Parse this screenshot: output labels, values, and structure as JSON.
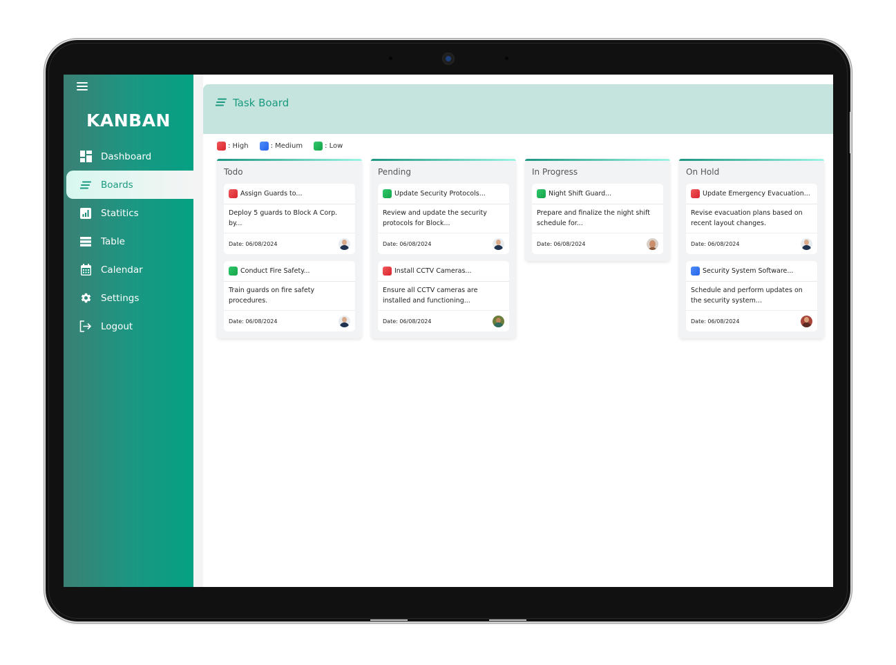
{
  "app": {
    "brand": "KANBAN",
    "menu_icon": "hamburger-icon"
  },
  "sidebar": {
    "items": [
      {
        "label": "Dashboard",
        "icon": "dashboard-icon",
        "active": false
      },
      {
        "label": "Boards",
        "icon": "boards-icon",
        "active": true
      },
      {
        "label": "Statitics",
        "icon": "statistics-icon",
        "active": false
      },
      {
        "label": "Table",
        "icon": "table-icon",
        "active": false
      },
      {
        "label": "Calendar",
        "icon": "calendar-icon",
        "active": false
      },
      {
        "label": "Settings",
        "icon": "gear-icon",
        "active": false
      },
      {
        "label": "Logout",
        "icon": "logout-icon",
        "active": false
      }
    ]
  },
  "header": {
    "title": "Task Board",
    "icon": "boards-icon"
  },
  "legend": [
    {
      "label": ": High",
      "priority": "high",
      "color": "#e53e3e"
    },
    {
      "label": ": Medium",
      "priority": "medium",
      "color": "#3b82f6"
    },
    {
      "label": ": Low",
      "priority": "low",
      "color": "#22c55e"
    }
  ],
  "colors": {
    "accent": "#1a9a80",
    "sidebar_start": "#3b8074",
    "sidebar_end": "#04a182",
    "header_band": "#c6e4de",
    "high": "#e53e3e",
    "medium": "#3b82f6",
    "low": "#22c55e"
  },
  "columns": [
    {
      "title": "Todo",
      "cards": [
        {
          "title": "Assign Guards to...",
          "priority": "high",
          "description": "Deploy 5 guards to Block A Corp. by...",
          "date": "Date: 06/08/2024",
          "avatar": "avatar-bald-man-dark-shirt"
        },
        {
          "title": "Conduct Fire Safety...",
          "priority": "low",
          "description": "Train guards on fire safety procedures.",
          "date": "Date: 06/08/2024",
          "avatar": "avatar-bald-man-dark-shirt"
        }
      ]
    },
    {
      "title": "Pending",
      "cards": [
        {
          "title": "Update Security Protocols...",
          "priority": "low",
          "description": "Review and update the security protocols for Block...",
          "date": "Date: 06/08/2024",
          "avatar": "avatar-bald-man-dark-shirt"
        },
        {
          "title": "Install CCTV Cameras...",
          "priority": "high",
          "description": "Ensure all CCTV cameras are installed and functioning...",
          "date": "Date: 06/08/2024",
          "avatar": "avatar-man-outdoor"
        }
      ]
    },
    {
      "title": "In Progress",
      "cards": [
        {
          "title": "Night Shift Guard...",
          "priority": "low",
          "description": "Prepare and finalize the night shift schedule for...",
          "date": "Date: 06/08/2024",
          "avatar": "avatar-bearded-man"
        }
      ]
    },
    {
      "title": "On Hold",
      "cards": [
        {
          "title": "Update Emergency Evacuation...",
          "priority": "high",
          "description": "Revise evacuation plans based on recent layout changes.",
          "date": "Date: 06/08/2024",
          "avatar": "avatar-bald-man-dark-shirt"
        },
        {
          "title": "Security System Software...",
          "priority": "medium",
          "description": "Schedule and perform updates on the security system...",
          "date": "Date: 06/08/2024",
          "avatar": "avatar-man-red-background"
        }
      ]
    }
  ]
}
